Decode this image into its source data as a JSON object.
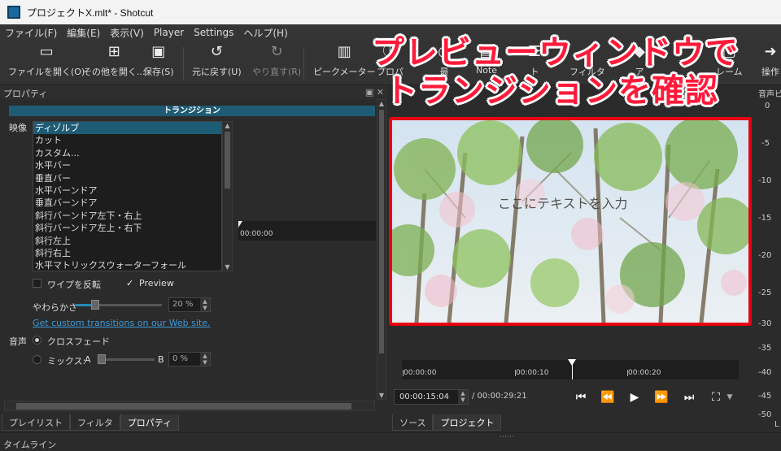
{
  "window": {
    "title": "プロジェクトX.mlt* - Shotcut"
  },
  "menu": [
    "ファイル(F)",
    "編集(E)",
    "表示(V)",
    "Player",
    "Settings",
    "ヘルプ(H)"
  ],
  "toolbar": {
    "open": "ファイルを開く(O)",
    "open_other": "その他を開く...",
    "save": "保存(S)",
    "undo": "元に戻す(U)",
    "redo": "やり直す(R)",
    "peak_meter": "ピークメーター",
    "properties": "プロパ",
    "recent": "最",
    "notes": "Note",
    "playlist": "ト",
    "filters": "フィルタ",
    "keyframes": "ア",
    "frame": "レーム",
    "markers": "操作"
  },
  "overlay": {
    "line1": "プレビューウィンドウで",
    "line2": "トランジションを確認"
  },
  "properties_panel": {
    "header": "プロパティ",
    "transition_title": "トランジション",
    "video_label": "映像",
    "video_options": [
      "ディゾルブ",
      "カット",
      "カスタム...",
      "水平バー",
      "垂直バー",
      "水平バーンドア",
      "垂直バーンドア",
      "斜行バーンドア左下・右上",
      "斜行バーンドア左上・右下",
      "斜行左上",
      "斜行右上",
      "水平マトリックスウォーターフォール"
    ],
    "selected_index": 0,
    "mini_timecode": "00:00:00",
    "invert_wipe": "ワイプを反転",
    "preview": "Preview",
    "preview_checked": true,
    "softness_label": "やわらかさ",
    "softness_value": "20 %",
    "softness_level": 0.2,
    "custom_link": "Get custom transitions on our Web site.",
    "audio_label": "音声",
    "crossfade": "クロスフェード",
    "mix": "ミックス:",
    "mix_a": "A",
    "mix_b": "B",
    "mix_value": "0 %"
  },
  "preview": {
    "caption": "ここにテキストを入力",
    "ruler": [
      "00:00:00",
      "00:00:10",
      "00:00:20"
    ],
    "playhead_fraction": 0.5,
    "current_time": "00:00:15:04",
    "duration": "/ 00:00:29:21"
  },
  "meter": {
    "header": "音声ピ",
    "scale": [
      "0",
      "-5",
      "-10",
      "-15",
      "-20",
      "-25",
      "-30",
      "-35",
      "-40",
      "-45",
      "-50"
    ],
    "channel": "L"
  },
  "tabs_left": [
    "プレイリスト",
    "フィルタ",
    "プロパティ"
  ],
  "tabs_right": [
    "ソース",
    "プロジェクト"
  ],
  "status": {
    "timeline": "タイムライン"
  },
  "colors": {
    "accent": "#1e5b74",
    "highlight": "#e60012",
    "overlay_text": "#ff1a3a"
  }
}
